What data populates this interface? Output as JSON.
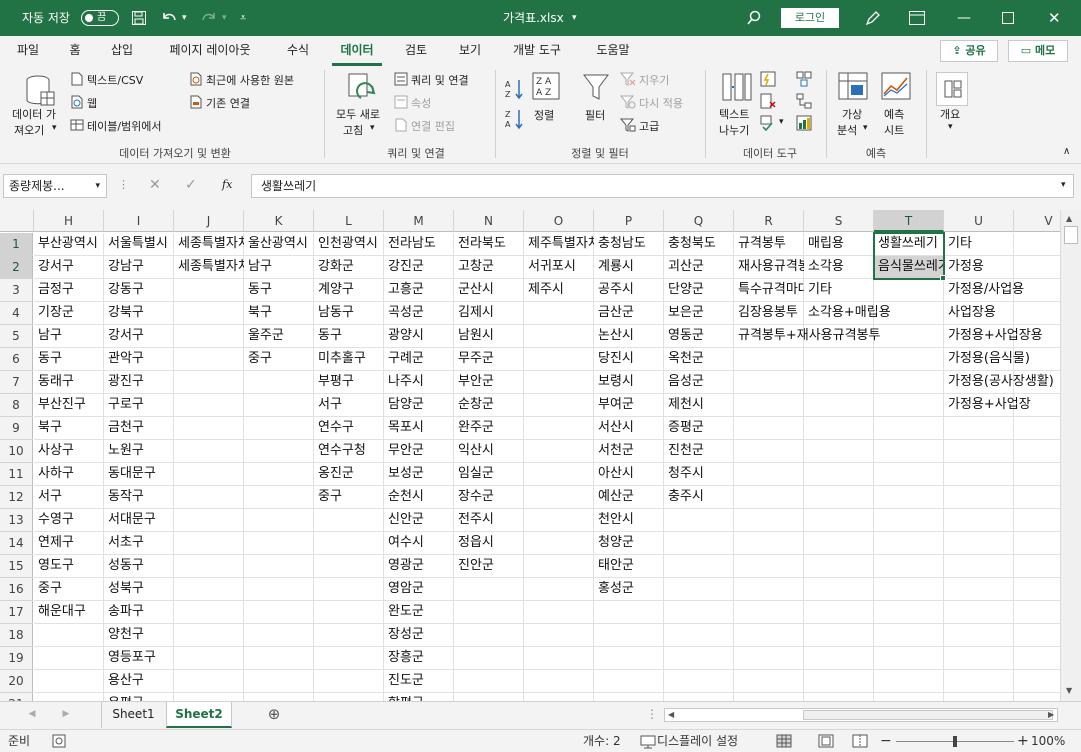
{
  "titlebar": {
    "autosave_label": "자동 저장",
    "autosave_state": "끔",
    "file_name": "가격표.xlsx",
    "login_label": "로그인"
  },
  "tabs": [
    "파일",
    "홈",
    "삽입",
    "페이지 레이아웃",
    "수식",
    "데이터",
    "검토",
    "보기",
    "개발 도구",
    "도움말"
  ],
  "active_tab": "데이터",
  "share_label": "공유",
  "memo_label": "메모",
  "ribbon": {
    "get_data": {
      "big_button": [
        "데이터 가",
        "져오기"
      ],
      "items": [
        "텍스트/CSV",
        "웹",
        "테이블/범위에서",
        "최근에 사용한 원본",
        "기존 연결"
      ],
      "group_label": "데이터 가져오기 및 변환"
    },
    "queries": {
      "big_button": [
        "모두 새로",
        "고침"
      ],
      "items": [
        "쿼리 및 연결",
        "속성",
        "연결 편집"
      ],
      "group_label": "쿼리 및 연결"
    },
    "sort_filter": {
      "sort": "정렬",
      "filter": "필터",
      "items": [
        "지우기",
        "다시 적용",
        "고급"
      ],
      "group_label": "정렬 및 필터"
    },
    "data_tools": {
      "big_button": [
        "텍스트",
        "나누기"
      ],
      "group_label": "데이터 도구"
    },
    "forecast": {
      "whatif": [
        "가상",
        "분석"
      ],
      "sheet": [
        "예측",
        "시트"
      ],
      "group_label": "예측"
    },
    "outline": {
      "label": "개요"
    }
  },
  "formula_bar": {
    "name_box": "종량제봉...",
    "fx": "fx",
    "content": "생활쓰레기"
  },
  "columns": [
    "H",
    "I",
    "J",
    "K",
    "L",
    "M",
    "N",
    "O",
    "P",
    "Q",
    "R",
    "S",
    "T",
    "U",
    "V"
  ],
  "selected_column": "T",
  "rows": [
    "1",
    "2",
    "3",
    "4",
    "5",
    "6",
    "7",
    "8",
    "9",
    "10",
    "11",
    "12",
    "13",
    "14",
    "15",
    "16",
    "17",
    "18",
    "19",
    "20",
    "21"
  ],
  "selected_rows": [
    "1",
    "2"
  ],
  "cells": [
    [
      "부산광역시",
      "서울특별시",
      "세종특별자치시",
      "울산광역시",
      "인천광역시",
      "전라남도",
      "전라북도",
      "제주특별자치도",
      "충청남도",
      "충청북도",
      "규격봉투",
      "매립용",
      "생활쓰레기",
      "기타",
      ""
    ],
    [
      "강서구",
      "강남구",
      "세종특별자치시",
      "남구",
      "강화군",
      "강진군",
      "고창군",
      "서귀포시",
      "계룡시",
      "괴산군",
      "재사용규격봉투",
      "소각용",
      "음식물쓰레기",
      "가정용",
      ""
    ],
    [
      "금정구",
      "강동구",
      "",
      "동구",
      "계양구",
      "고흥군",
      "군산시",
      "제주시",
      "공주시",
      "단양군",
      "특수규격마대",
      "기타",
      "",
      "가정용/사업용",
      ""
    ],
    [
      "기장군",
      "강북구",
      "",
      "북구",
      "남동구",
      "곡성군",
      "김제시",
      "",
      "금산군",
      "보은군",
      "김장용봉투",
      "소각용+매립용",
      "",
      "사업장용",
      ""
    ],
    [
      "남구",
      "강서구",
      "",
      "울주군",
      "동구",
      "광양시",
      "남원시",
      "",
      "논산시",
      "영동군",
      "규격봉투+재사용규격봉투",
      "",
      "",
      "가정용+사업장용",
      ""
    ],
    [
      "동구",
      "관악구",
      "",
      "중구",
      "미추홀구",
      "구례군",
      "무주군",
      "",
      "당진시",
      "옥천군",
      "",
      "",
      "",
      "가정용(음식물)",
      ""
    ],
    [
      "동래구",
      "광진구",
      "",
      "",
      "부평구",
      "나주시",
      "부안군",
      "",
      "보령시",
      "음성군",
      "",
      "",
      "",
      "가정용(공사장생활)",
      ""
    ],
    [
      "부산진구",
      "구로구",
      "",
      "",
      "서구",
      "담양군",
      "순창군",
      "",
      "부여군",
      "제천시",
      "",
      "",
      "",
      "가정용+사업장",
      ""
    ],
    [
      "북구",
      "금천구",
      "",
      "",
      "연수구",
      "목포시",
      "완주군",
      "",
      "서산시",
      "증평군",
      "",
      "",
      "",
      "",
      ""
    ],
    [
      "사상구",
      "노원구",
      "",
      "",
      "연수구청",
      "무안군",
      "익산시",
      "",
      "서천군",
      "진천군",
      "",
      "",
      "",
      "",
      ""
    ],
    [
      "사하구",
      "동대문구",
      "",
      "",
      "옹진군",
      "보성군",
      "임실군",
      "",
      "아산시",
      "청주시",
      "",
      "",
      "",
      "",
      ""
    ],
    [
      "서구",
      "동작구",
      "",
      "",
      "중구",
      "순천시",
      "장수군",
      "",
      "예산군",
      "충주시",
      "",
      "",
      "",
      "",
      ""
    ],
    [
      "수영구",
      "서대문구",
      "",
      "",
      "",
      "신안군",
      "전주시",
      "",
      "천안시",
      "",
      "",
      "",
      "",
      "",
      ""
    ],
    [
      "연제구",
      "서초구",
      "",
      "",
      "",
      "여수시",
      "정읍시",
      "",
      "청양군",
      "",
      "",
      "",
      "",
      "",
      ""
    ],
    [
      "영도구",
      "성동구",
      "",
      "",
      "",
      "영광군",
      "진안군",
      "",
      "태안군",
      "",
      "",
      "",
      "",
      "",
      ""
    ],
    [
      "중구",
      "성북구",
      "",
      "",
      "",
      "영암군",
      "",
      "",
      "홍성군",
      "",
      "",
      "",
      "",
      "",
      ""
    ],
    [
      "해운대구",
      "송파구",
      "",
      "",
      "",
      "완도군",
      "",
      "",
      "",
      "",
      "",
      "",
      "",
      "",
      ""
    ],
    [
      "",
      "양천구",
      "",
      "",
      "",
      "장성군",
      "",
      "",
      "",
      "",
      "",
      "",
      "",
      "",
      ""
    ],
    [
      "",
      "영등포구",
      "",
      "",
      "",
      "장흥군",
      "",
      "",
      "",
      "",
      "",
      "",
      "",
      "",
      ""
    ],
    [
      "",
      "용산구",
      "",
      "",
      "",
      "진도군",
      "",
      "",
      "",
      "",
      "",
      "",
      "",
      "",
      ""
    ],
    [
      "",
      "은평구",
      "",
      "",
      "",
      "함평군",
      "",
      "",
      "",
      "",
      "",
      "",
      "",
      "",
      ""
    ]
  ],
  "sheets": [
    "Sheet1",
    "Sheet2"
  ],
  "active_sheet": "Sheet2",
  "status": {
    "ready": "준비",
    "count": "개수: 2",
    "display_settings": "디스플레이 설정",
    "zoom": "100%",
    "zoom_level": 1.0
  },
  "colors": {
    "accent": "#217346",
    "ribbon_bg": "#f3f3f3"
  }
}
